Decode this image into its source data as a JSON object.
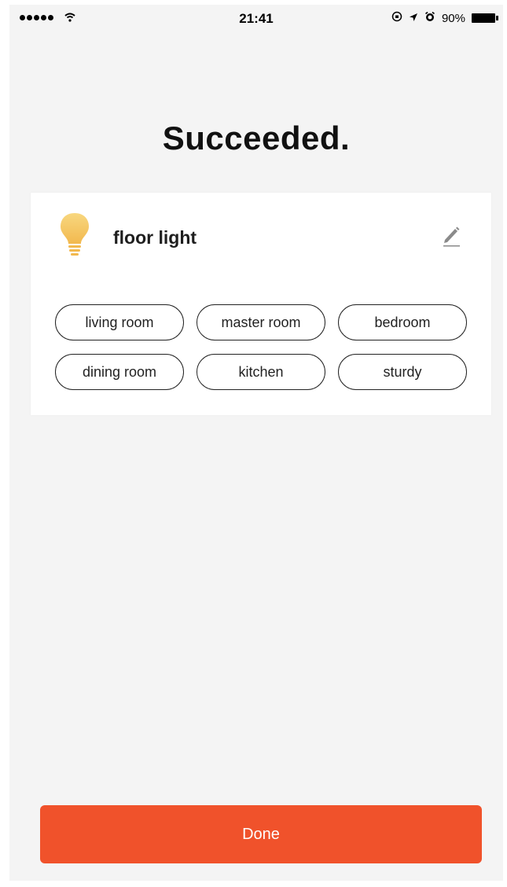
{
  "status_bar": {
    "time": "21:41",
    "battery_percent": "90%",
    "signal_bars": 5,
    "icons": [
      "wifi-icon",
      "orientation-lock-icon",
      "location-icon",
      "alarm-icon",
      "battery-icon"
    ]
  },
  "page": {
    "title": "Succeeded."
  },
  "device": {
    "name": "floor light",
    "icon": "light-bulb-icon",
    "edit_icon": "pencil-icon",
    "bulb_color": "#f5c96a"
  },
  "rooms": [
    {
      "label": "living room"
    },
    {
      "label": "master room"
    },
    {
      "label": "bedroom"
    },
    {
      "label": "dining room"
    },
    {
      "label": "kitchen"
    },
    {
      "label": "sturdy"
    }
  ],
  "footer": {
    "done_label": "Done",
    "accent_color": "#f0522b"
  }
}
